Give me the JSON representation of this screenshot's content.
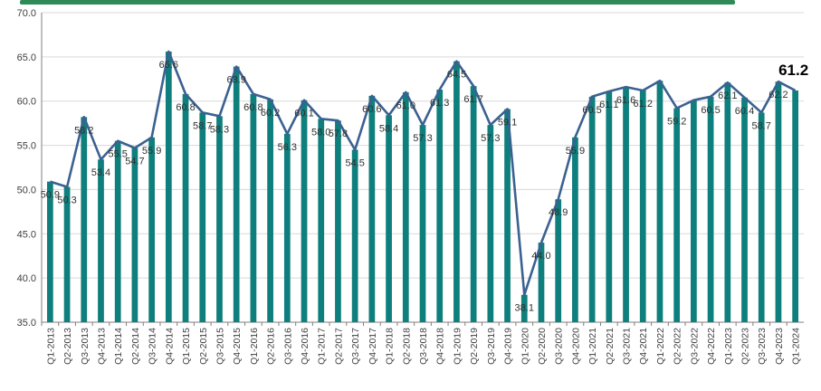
{
  "chart_data": {
    "type": "bar",
    "overlay": "line",
    "categories": [
      "Q1-2013",
      "Q2-2013",
      "Q3-2013",
      "Q4-2013",
      "Q1-2014",
      "Q2-2014",
      "Q3-2014",
      "Q4-2014",
      "Q1-2015",
      "Q2-2015",
      "Q3-2015",
      "Q4-2015",
      "Q1-2016",
      "Q2-2016",
      "Q3-2016",
      "Q4-2016",
      "Q1-2017",
      "Q2-2017",
      "Q3-2017",
      "Q4-2017",
      "Q1-2018",
      "Q2-2018",
      "Q3-2018",
      "Q4-2018",
      "Q1-2019",
      "Q2-2019",
      "Q3-2019",
      "Q4-2019",
      "Q1-2020",
      "Q2-2020",
      "Q3-2020",
      "Q4-2020",
      "Q1-2021",
      "Q2-2021",
      "Q3-2021",
      "Q4-2021",
      "Q1-2022",
      "Q2-2022",
      "Q3-2022",
      "Q4-2022",
      "Q1-2023",
      "Q2-2023",
      "Q3-2023",
      "Q4-2023",
      "Q1-2024"
    ],
    "values": [
      50.9,
      50.3,
      58.2,
      53.4,
      55.5,
      54.7,
      55.9,
      65.6,
      60.8,
      58.7,
      58.3,
      63.9,
      60.8,
      60.2,
      56.3,
      60.1,
      58.0,
      57.8,
      54.5,
      60.6,
      58.4,
      61.0,
      57.3,
      61.3,
      64.5,
      61.7,
      57.3,
      59.1,
      38.1,
      44.0,
      48.9,
      55.9,
      60.5,
      61.1,
      61.6,
      61.2,
      62.3,
      59.2,
      60.1,
      60.5,
      62.1,
      60.4,
      58.7,
      62.2,
      61.2
    ],
    "labels": [
      "50.9",
      "50.3",
      "58.2",
      "53.4",
      "55.5",
      "54.7",
      "55.9",
      "65.6",
      "60.8",
      "58.7",
      "58.3",
      "63.9",
      "60.8",
      "60.2",
      "56.3",
      "60.1",
      "58.0",
      "57.8",
      "54.5",
      "60.6",
      "58.4",
      "61.0",
      "57.3",
      "61.3",
      "64.5",
      "61.7",
      "57.3",
      "59.1",
      "38.1",
      "44.0",
      "48.9",
      "55.9",
      "60.5",
      "61.1",
      "61.6",
      "61.2",
      "62.3",
      "59.2",
      "60.1",
      "60.5",
      "62.1",
      "60.4",
      "58.7",
      "62.2",
      "61.2"
    ],
    "visible_labels": [
      "50.9",
      "50.3",
      "58.2",
      "53.4",
      "55.5",
      "54.7",
      "55.9",
      "65.6",
      "60.8",
      "58.7",
      "58.3",
      "63.9",
      "60.8",
      "60.2",
      "56.3",
      "60.1",
      "58.0",
      "57.8",
      "54.5",
      "60.6",
      "58.4",
      "61.0",
      "57.3",
      "61.3",
      "64.5",
      "61.7",
      "57.3",
      "59.1",
      "38.1",
      "44.0",
      "48.9",
      "55.9",
      "60.5",
      "61.1",
      "61.6",
      "61.2",
      "",
      "59.2",
      "",
      "60.5",
      "62.1",
      "60.4",
      "58.7",
      "62.2",
      "61.2"
    ],
    "last_label": "61.2",
    "yticks": [
      "35.0",
      "40.0",
      "45.0",
      "50.0",
      "55.0",
      "60.0",
      "65.0",
      "70.0"
    ],
    "ylim": [
      35,
      70
    ],
    "grid": true,
    "colors": {
      "bar": "#0e7f7c",
      "line": "#3b6191",
      "grid": "#d9d9d9",
      "axis": "#7f7f7f",
      "top_band": "#2e8b57"
    }
  }
}
